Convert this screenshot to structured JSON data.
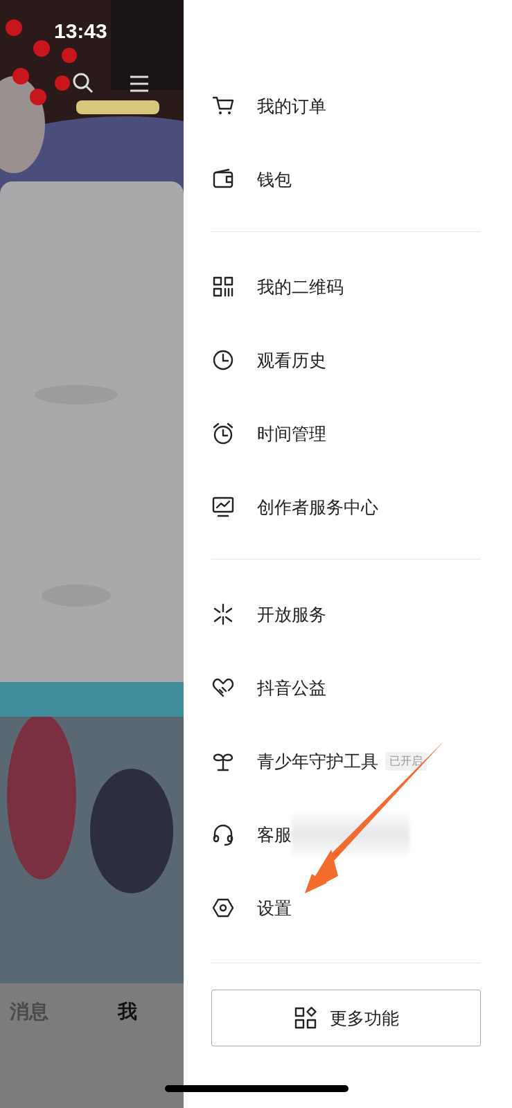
{
  "status_bar": {
    "time": "13:43"
  },
  "bottom_tabs": [
    {
      "label": "消息",
      "selected": false
    },
    {
      "label": "我",
      "selected": true
    }
  ],
  "drawer": {
    "sections": [
      [
        {
          "label": "我的订单",
          "redacted": false
        },
        {
          "label": "钱包",
          "redacted": false
        }
      ],
      [
        {
          "label": "我的二维码",
          "redacted": false
        },
        {
          "label": "观看历史",
          "redacted": false
        },
        {
          "label": "时间管理",
          "redacted": false
        },
        {
          "label": "创作者服务中心",
          "redacted": false
        }
      ],
      [
        {
          "label": "开放服务",
          "redacted": false
        },
        {
          "label": "抖音公益",
          "redacted": false
        },
        {
          "label": "青少年守护工具",
          "badge": "已开启",
          "redacted": false
        },
        {
          "label": "客服",
          "redacted": true
        },
        {
          "label": "设置",
          "redacted": false
        }
      ]
    ],
    "more_button": {
      "label": "更多功能"
    }
  }
}
